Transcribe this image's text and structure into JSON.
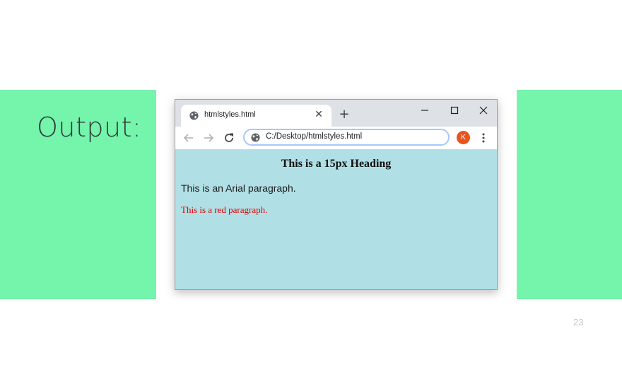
{
  "slide": {
    "label": "Output:",
    "page_number": "23",
    "accent_color": "#75f4ac"
  },
  "browser": {
    "tab": {
      "title": "htmlstyles.html",
      "close_glyph": "✕",
      "favicon": "globe-icon"
    },
    "new_tab_glyph": "+",
    "address_bar": {
      "url": "C:/Desktop/htmlstyles.html",
      "icon": "globe-icon"
    },
    "profile_initial": "K",
    "profile_color": "#e8541f"
  },
  "page": {
    "background_color": "#b0dfe5",
    "heading": "This is a 15px Heading",
    "arial_paragraph": "This is an Arial paragraph.",
    "red_paragraph": "This is a red paragraph.",
    "red_color": "#e00000"
  }
}
